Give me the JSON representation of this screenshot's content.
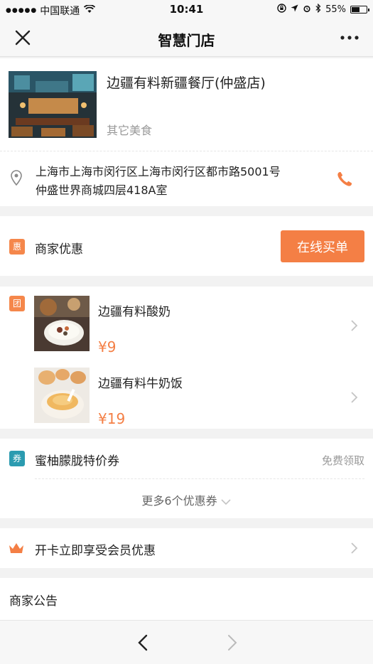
{
  "status_bar": {
    "carrier": "中国联通",
    "time": "10:41",
    "battery": "55%",
    "battery_level": 0.55
  },
  "nav": {
    "title": "智慧门店"
  },
  "store": {
    "name": "边疆有料新疆餐厅(仲盛店)",
    "category": "其它美食",
    "address_line1": "上海市上海市闵行区上海市闵行区都市路5001号",
    "address_line2": "仲盛世界商城四层418A室"
  },
  "offers": {
    "tag": "惠",
    "label": "商家优惠",
    "button": "在线买单"
  },
  "deals": {
    "tag": "团",
    "items": [
      {
        "name": "边疆有料酸奶",
        "price": "¥9"
      },
      {
        "name": "边疆有料牛奶饭",
        "price": "¥19"
      }
    ]
  },
  "coupons": {
    "tag": "券",
    "name": "蜜柚朦胧特价券",
    "action": "免费领取",
    "more": "更多6个优惠券"
  },
  "member": {
    "label": "开卡立即享受会员优惠"
  },
  "notice": {
    "label": "商家公告"
  },
  "colors": {
    "accent": "#f47f45",
    "coupon_tag": "#2b9bb0"
  }
}
